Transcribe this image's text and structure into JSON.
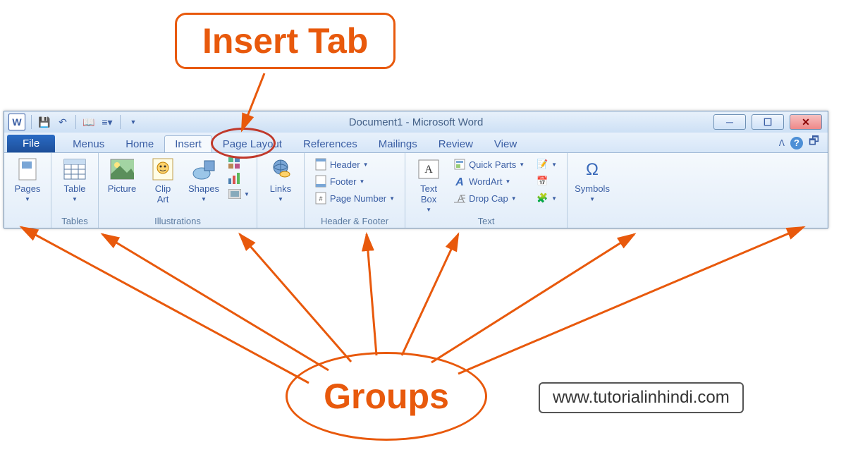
{
  "callouts": {
    "top": "Insert Tab",
    "bottom": "Groups"
  },
  "url": "www.tutorialinhindi.com",
  "title": "Document1  -  Microsoft Word",
  "tabs": {
    "file": "File",
    "menus": "Menus",
    "home": "Home",
    "insert": "Insert",
    "pagelayout": "Page Layout",
    "references": "References",
    "mailings": "Mailings",
    "review": "Review",
    "view": "View"
  },
  "groups": {
    "pages": {
      "btn": "Pages"
    },
    "tables": {
      "label": "Tables",
      "btn": "Table"
    },
    "illustrations": {
      "label": "Illustrations",
      "picture": "Picture",
      "clipart": "Clip\nArt",
      "shapes": "Shapes"
    },
    "links": {
      "btn": "Links"
    },
    "headerfooter": {
      "label": "Header & Footer",
      "header": "Header",
      "footer": "Footer",
      "pagenum": "Page Number"
    },
    "text": {
      "label": "Text",
      "textbox": "Text\nBox",
      "quickparts": "Quick Parts",
      "wordart": "WordArt",
      "dropcap": "Drop Cap"
    },
    "symbols": {
      "btn": "Symbols"
    }
  }
}
